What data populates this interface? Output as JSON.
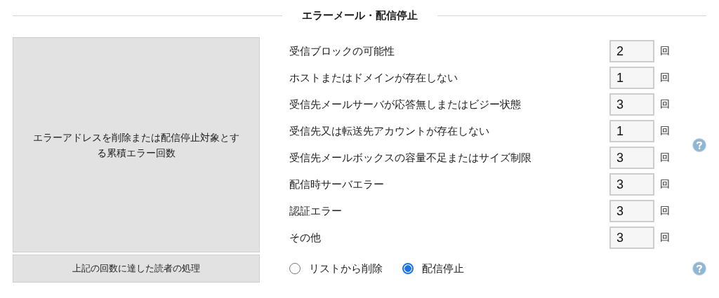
{
  "section_title": "エラーメール・配信停止",
  "threshold_label": "エラーアドレスを削除または配信停止対象とする累積エラー回数",
  "error_types": [
    {
      "label": "受信ブロックの可能性",
      "value": "2",
      "unit": "回"
    },
    {
      "label": "ホストまたはドメインが存在しない",
      "value": "1",
      "unit": "回"
    },
    {
      "label": "受信先メールサーバが応答無しまたはビジー状態",
      "value": "3",
      "unit": "回"
    },
    {
      "label": "受信先又は転送先アカウントが存在しない",
      "value": "1",
      "unit": "回"
    },
    {
      "label": "受信先メールボックスの容量不足またはサイズ制限",
      "value": "3",
      "unit": "回"
    },
    {
      "label": "配信時サーバエラー",
      "value": "3",
      "unit": "回"
    },
    {
      "label": "認証エラー",
      "value": "3",
      "unit": "回"
    },
    {
      "label": "その他",
      "value": "3",
      "unit": "回"
    }
  ],
  "action_label": "上記の回数に達した読者の処理",
  "actions": [
    {
      "label": "リストから削除",
      "selected": false
    },
    {
      "label": "配信停止",
      "selected": true
    }
  ]
}
